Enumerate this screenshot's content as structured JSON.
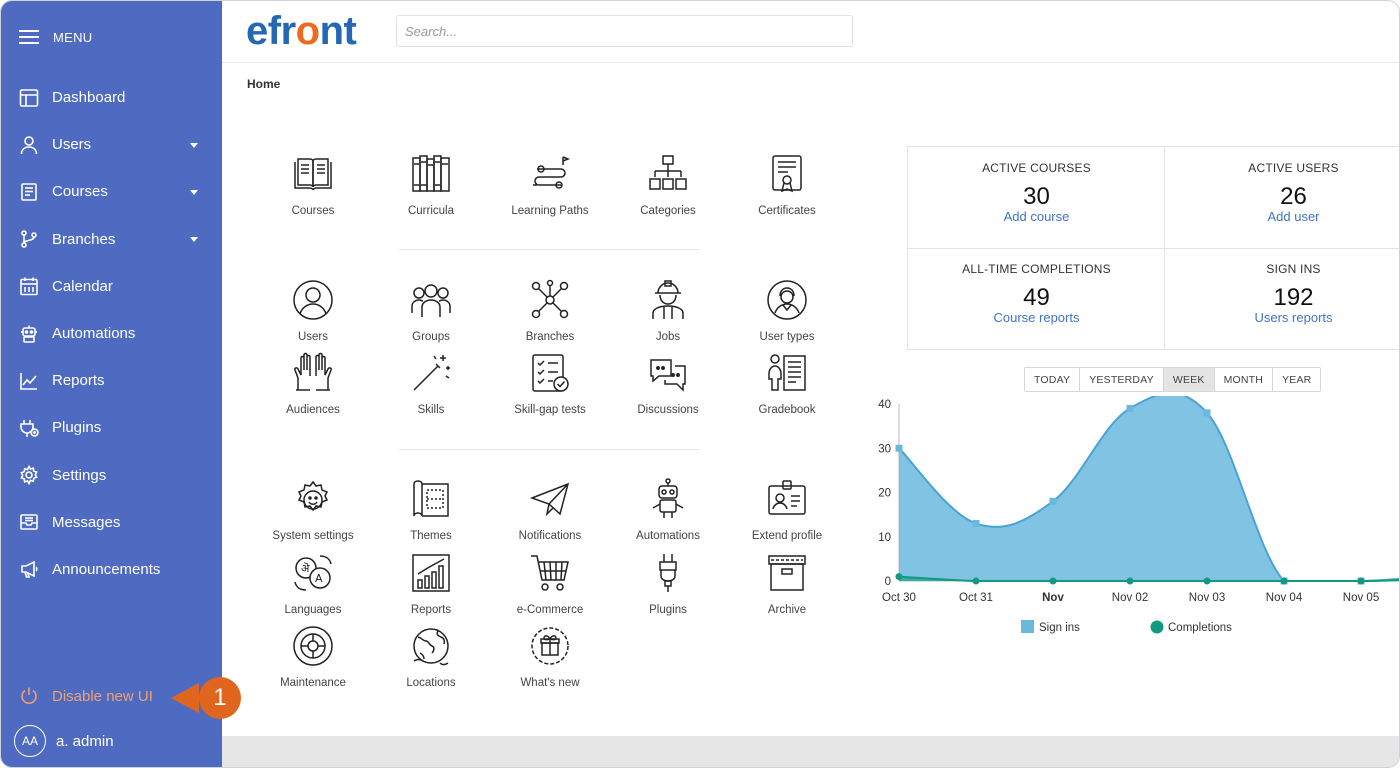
{
  "sidebar": {
    "menu_label": "MENU",
    "items": [
      {
        "label": "Dashboard",
        "icon": "dashboard-icon",
        "has_caret": false
      },
      {
        "label": "Users",
        "icon": "user-icon",
        "has_caret": true
      },
      {
        "label": "Courses",
        "icon": "book-icon",
        "has_caret": true
      },
      {
        "label": "Branches",
        "icon": "branch-icon",
        "has_caret": true
      },
      {
        "label": "Calendar",
        "icon": "calendar-icon",
        "has_caret": false
      },
      {
        "label": "Automations",
        "icon": "robot-icon",
        "has_caret": false
      },
      {
        "label": "Reports",
        "icon": "chart-line-icon",
        "has_caret": false
      },
      {
        "label": "Plugins",
        "icon": "plug-icon",
        "has_caret": false
      },
      {
        "label": "Settings",
        "icon": "gear-icon",
        "has_caret": false
      },
      {
        "label": "Messages",
        "icon": "inbox-icon",
        "has_caret": false
      },
      {
        "label": "Announcements",
        "icon": "megaphone-icon",
        "has_caret": false
      }
    ],
    "disable_label": "Disable new UI",
    "user_initials": "AA",
    "user_name": "a. admin",
    "callout_number": "1"
  },
  "header": {
    "logo_prefix": "efr",
    "logo_o": "o",
    "logo_suffix": "nt",
    "search_placeholder": "Search..."
  },
  "breadcrumb": "Home",
  "tiles": [
    {
      "label": "Courses",
      "icon": "open-book-icon"
    },
    {
      "label": "Curricula",
      "icon": "bookshelf-icon"
    },
    {
      "label": "Learning Paths",
      "icon": "path-icon"
    },
    {
      "label": "Categories",
      "icon": "hierarchy-icon"
    },
    {
      "label": "Certificates",
      "icon": "certificate-icon"
    },
    {
      "label": "Users",
      "icon": "user-circle-icon"
    },
    {
      "label": "Groups",
      "icon": "group-icon"
    },
    {
      "label": "Branches",
      "icon": "network-icon"
    },
    {
      "label": "Jobs",
      "icon": "worker-icon"
    },
    {
      "label": "User types",
      "icon": "user-type-icon"
    },
    {
      "label": "Audiences",
      "icon": "raised-hands-icon"
    },
    {
      "label": "Skills",
      "icon": "magic-wand-icon"
    },
    {
      "label": "Skill-gap tests",
      "icon": "checklist-icon"
    },
    {
      "label": "Discussions",
      "icon": "chat-bubbles-icon"
    },
    {
      "label": "Gradebook",
      "icon": "gradebook-icon"
    },
    {
      "label": "System settings",
      "icon": "settings-smile-icon"
    },
    {
      "label": "Themes",
      "icon": "blueprint-icon"
    },
    {
      "label": "Notifications",
      "icon": "paper-plane-icon"
    },
    {
      "label": "Automations",
      "icon": "robot-icon"
    },
    {
      "label": "Extend profile",
      "icon": "id-card-icon"
    },
    {
      "label": "Languages",
      "icon": "translate-icon"
    },
    {
      "label": "Reports",
      "icon": "bar-chart-icon"
    },
    {
      "label": "e-Commerce",
      "icon": "cart-icon"
    },
    {
      "label": "Plugins",
      "icon": "plug-icon"
    },
    {
      "label": "Archive",
      "icon": "archive-box-icon"
    },
    {
      "label": "Maintenance",
      "icon": "maintenance-icon"
    },
    {
      "label": "Locations",
      "icon": "globe-icon"
    },
    {
      "label": "What's new",
      "icon": "gift-icon"
    }
  ],
  "stats": [
    {
      "title": "ACTIVE COURSES",
      "value": "30",
      "link": "Add course"
    },
    {
      "title": "ACTIVE USERS",
      "value": "26",
      "link": "Add user"
    },
    {
      "title": "ALL-TIME COMPLETIONS",
      "value": "49",
      "link": "Course reports"
    },
    {
      "title": "SIGN INS",
      "value": "192",
      "link": "Users reports"
    }
  ],
  "range_buttons": [
    "TODAY",
    "YESTERDAY",
    "WEEK",
    "MONTH",
    "YEAR"
  ],
  "range_active": "WEEK",
  "colors": {
    "sidebar": "#4e6bc1",
    "accent": "#2367b5",
    "logo_orange": "#ee6a1e",
    "link": "#3f74c8",
    "signins": "#6bb8de",
    "completions": "#119a7f",
    "callout": "#e0661f"
  },
  "chart_data": {
    "type": "area",
    "categories": [
      "Oct 30",
      "Oct 31",
      "Nov",
      "Nov 02",
      "Nov 03",
      "Nov 04",
      "Nov 05"
    ],
    "bold_category": "Nov",
    "ylim": [
      0,
      40
    ],
    "yticks": [
      0,
      10,
      20,
      30,
      40
    ],
    "series": [
      {
        "name": "Sign ins",
        "values": [
          30,
          13,
          18,
          39,
          38,
          0,
          0
        ]
      },
      {
        "name": "Completions",
        "values": [
          1,
          0,
          0,
          0,
          0,
          0,
          0
        ]
      }
    ],
    "legend_position": "bottom"
  }
}
